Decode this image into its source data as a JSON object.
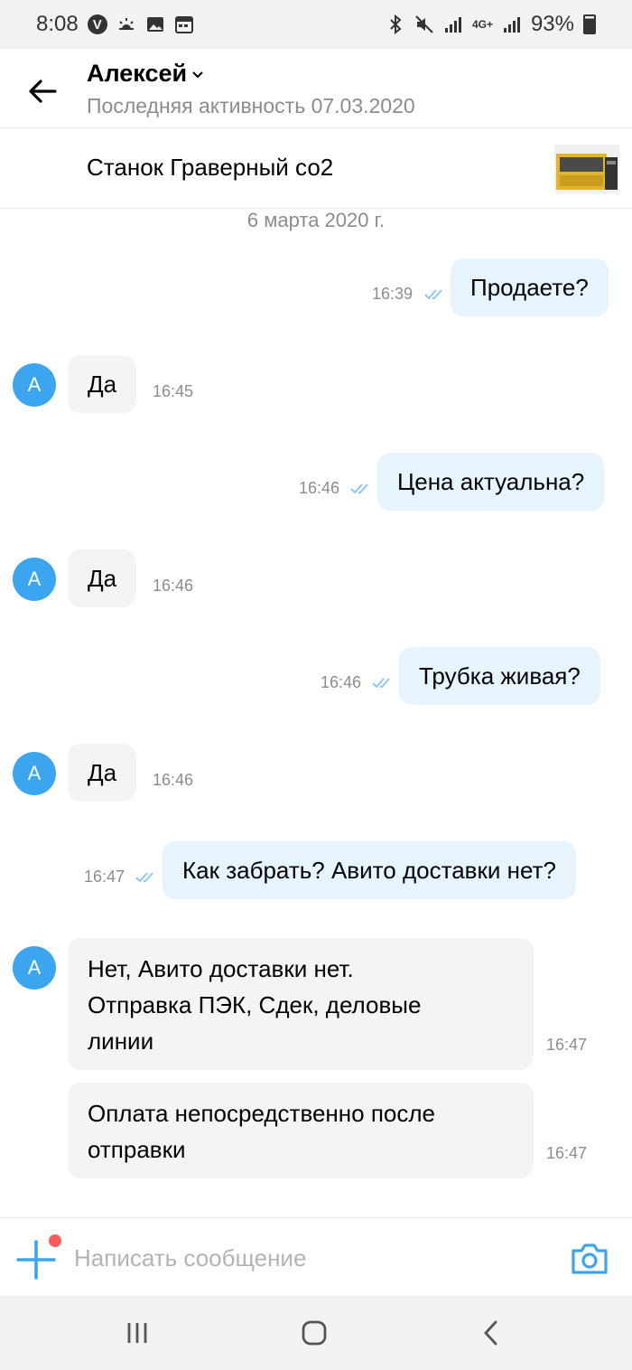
{
  "status_bar": {
    "time": "8:08",
    "network": "4G+",
    "battery": "93%"
  },
  "header": {
    "title": "Алексей",
    "subtitle": "Последняя активность 07.03.2020"
  },
  "item": {
    "name": "Станок Граверный со2"
  },
  "chat": {
    "date_separator": "6 марта 2020 г.",
    "avatar_letter": "А",
    "messages": [
      {
        "direction": "out",
        "text": "Продаете?",
        "time": "16:39",
        "read": true
      },
      {
        "direction": "in",
        "text": "Да",
        "time": "16:45"
      },
      {
        "direction": "out",
        "text": "Цена актуальна?",
        "time": "16:46",
        "read": true
      },
      {
        "direction": "in",
        "text": "Да",
        "time": "16:46"
      },
      {
        "direction": "out",
        "text": "Трубка живая?",
        "time": "16:46",
        "read": true
      },
      {
        "direction": "in",
        "text": "Да",
        "time": "16:46"
      },
      {
        "direction": "out",
        "text": "Как забрать? Авито доставки нет?",
        "time": "16:47",
        "read": true
      },
      {
        "direction": "in",
        "lines": [
          "Нет, Авито доставки нет.",
          "Отправка ПЭК, Сдек, деловые",
          "линии"
        ],
        "time": "16:47"
      },
      {
        "direction": "in",
        "lines": [
          "Оплата непосредственно после",
          "отправки"
        ],
        "time": "16:47"
      }
    ]
  },
  "composer": {
    "placeholder": "Написать сообщение"
  },
  "colors": {
    "accent": "#3ba5f0",
    "outgoing_bubble": "#e5f4fd",
    "incoming_bubble": "#f4f4f4",
    "notification_dot": "#ff5a5a"
  }
}
